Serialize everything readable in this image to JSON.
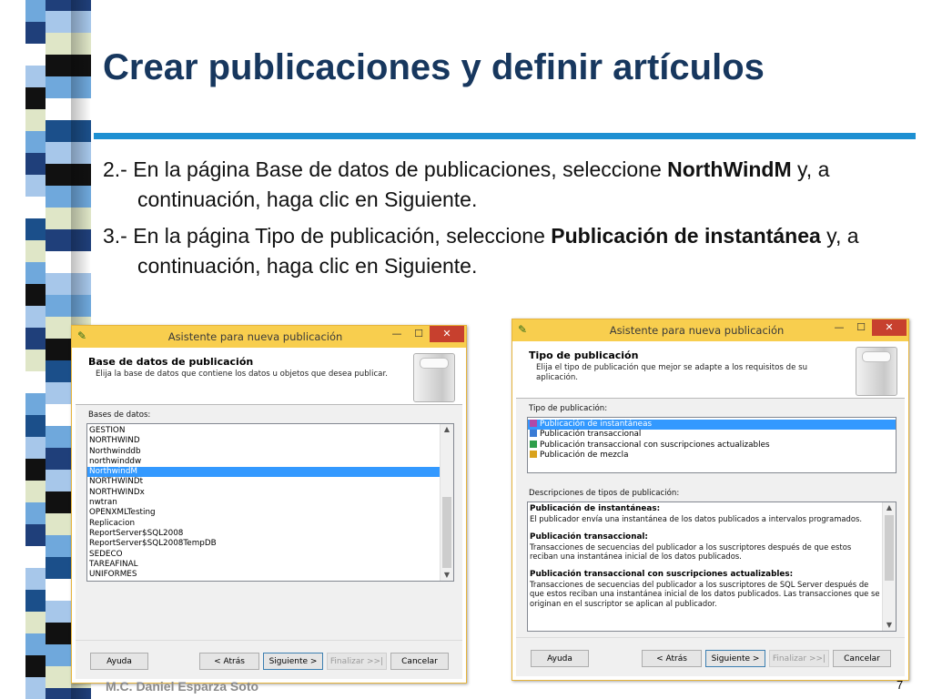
{
  "slide": {
    "title": "Crear publicaciones y definir artículos",
    "paragraphs": [
      {
        "before": "2.- En la página Base de datos de publicaciones, seleccione ",
        "bold": "NorthWindM",
        "after": " y, a continuación, haga clic en Siguiente."
      },
      {
        "before": "3.- En la página Tipo de publicación, seleccione ",
        "bold": "Publicación de instantánea",
        "after": " y, a continuación, haga clic en Siguiente."
      }
    ],
    "footer_author": "M.C. Daniel Esparza Soto",
    "page_number": "7"
  },
  "colors": {
    "title": "#17375e",
    "rule": "#1e90d2",
    "titlebar": "#f8ce4e",
    "selection": "#3399ff",
    "close": "#c7402e"
  },
  "stripes": {
    "col_a": [
      "#6fa8dc",
      "#1f3f7a",
      "#ffffff",
      "#a7c7ea",
      "#111111",
      "#dfe6c7",
      "#6fa8dc",
      "#1f3f7a",
      "#a7c7ea",
      "#ffffff",
      "#1b4f8a",
      "#dfe6c7",
      "#6fa8dc",
      "#111111",
      "#a7c7ea",
      "#1f3f7a",
      "#dfe6c7",
      "#ffffff",
      "#6fa8dc",
      "#1b4f8a",
      "#a7c7ea",
      "#111111",
      "#dfe6c7",
      "#6fa8dc",
      "#1f3f7a",
      "#ffffff",
      "#a7c7ea",
      "#1b4f8a",
      "#dfe6c7",
      "#6fa8dc",
      "#111111",
      "#a7c7ea",
      "#1f3f7a"
    ],
    "col_b": [
      "#1f3f7a",
      "#a7c7ea",
      "#dfe6c7",
      "#111111",
      "#6fa8dc",
      "#ffffff",
      "#1b4f8a",
      "#a7c7ea",
      "#111111",
      "#6fa8dc",
      "#dfe6c7",
      "#1f3f7a",
      "#ffffff",
      "#a7c7ea",
      "#6fa8dc",
      "#dfe6c7",
      "#111111",
      "#1b4f8a",
      "#a7c7ea",
      "#ffffff",
      "#6fa8dc",
      "#1f3f7a",
      "#a7c7ea",
      "#111111",
      "#dfe6c7",
      "#6fa8dc",
      "#1b4f8a",
      "#ffffff",
      "#a7c7ea",
      "#111111",
      "#6fa8dc",
      "#dfe6c7",
      "#1f3f7a"
    ]
  },
  "dialog1": {
    "app_icon": "wizard-icon",
    "title": "Asistente para nueva publicación",
    "min_label": "—",
    "max_label": "☐",
    "close_label": "✕",
    "header_title": "Base de datos de publicación",
    "header_subtitle": "Elija la base de datos que contiene los datos u objetos que desea publicar.",
    "list_label": "Bases de datos:",
    "databases": [
      {
        "name": "GESTION",
        "selected": false
      },
      {
        "name": "NORTHWIND",
        "selected": false
      },
      {
        "name": "Northwinddb",
        "selected": false
      },
      {
        "name": "northwinddw",
        "selected": false
      },
      {
        "name": "NorthwindM",
        "selected": true
      },
      {
        "name": "NORTHWINDt",
        "selected": false
      },
      {
        "name": "NORTHWINDx",
        "selected": false
      },
      {
        "name": "nwtran",
        "selected": false
      },
      {
        "name": "OPENXMLTesting",
        "selected": false
      },
      {
        "name": "Replicacion",
        "selected": false
      },
      {
        "name": "ReportServer$SQL2008",
        "selected": false
      },
      {
        "name": "ReportServer$SQL2008TempDB",
        "selected": false
      },
      {
        "name": "SEDECO",
        "selected": false
      },
      {
        "name": "TAREAFINAL",
        "selected": false
      },
      {
        "name": "UNIFORMES",
        "selected": false
      }
    ],
    "buttons": {
      "help": "Ayuda",
      "back": "< Atrás",
      "next": "Siguiente >",
      "finish": "Finalizar >>|",
      "cancel": "Cancelar"
    }
  },
  "dialog2": {
    "app_icon": "wizard-icon",
    "title": "Asistente para nueva publicación",
    "min_label": "—",
    "max_label": "☐",
    "close_label": "✕",
    "header_title": "Tipo de publicación",
    "header_subtitle_1": "Elija el tipo de publicación que mejor se adapte a los requisitos de su",
    "header_subtitle_2": "aplicación.",
    "type_label": "Tipo de publicación:",
    "types": [
      {
        "name": "Publicación de instantáneas",
        "selected": true,
        "icon": "snapshot-publication-icon",
        "color": "#b04aa8"
      },
      {
        "name": "Publicación transaccional",
        "selected": false,
        "icon": "transactional-publication-icon",
        "color": "#3a7bd5"
      },
      {
        "name": "Publicación transaccional con suscripciones actualizables",
        "selected": false,
        "icon": "updatable-publication-icon",
        "color": "#2e9e4a"
      },
      {
        "name": "Publicación de mezcla",
        "selected": false,
        "icon": "merge-publication-icon",
        "color": "#d9a21c"
      }
    ],
    "desc_label": "Descripciones de tipos de publicación:",
    "descriptions": [
      {
        "title": "Publicación de instantáneas:",
        "lines": [
          "El publicador envía una instantánea de los datos publicados a intervalos programados."
        ]
      },
      {
        "title": "Publicación transaccional:",
        "lines": [
          "Transacciones de secuencias del publicador a los suscriptores después de que estos",
          "reciban una instantánea inicial de los datos publicados."
        ]
      },
      {
        "title": "Publicación transaccional con suscripciones actualizables:",
        "lines": [
          "Transacciones de secuencias del publicador a los suscriptores de SQL Server después de",
          "que estos reciban una instantánea inicial de los datos publicados. Las transacciones que se",
          "originan en el suscriptor se aplican al publicador."
        ]
      }
    ],
    "buttons": {
      "help": "Ayuda",
      "back": "< Atrás",
      "next": "Siguiente >",
      "finish": "Finalizar >>|",
      "cancel": "Cancelar"
    }
  }
}
